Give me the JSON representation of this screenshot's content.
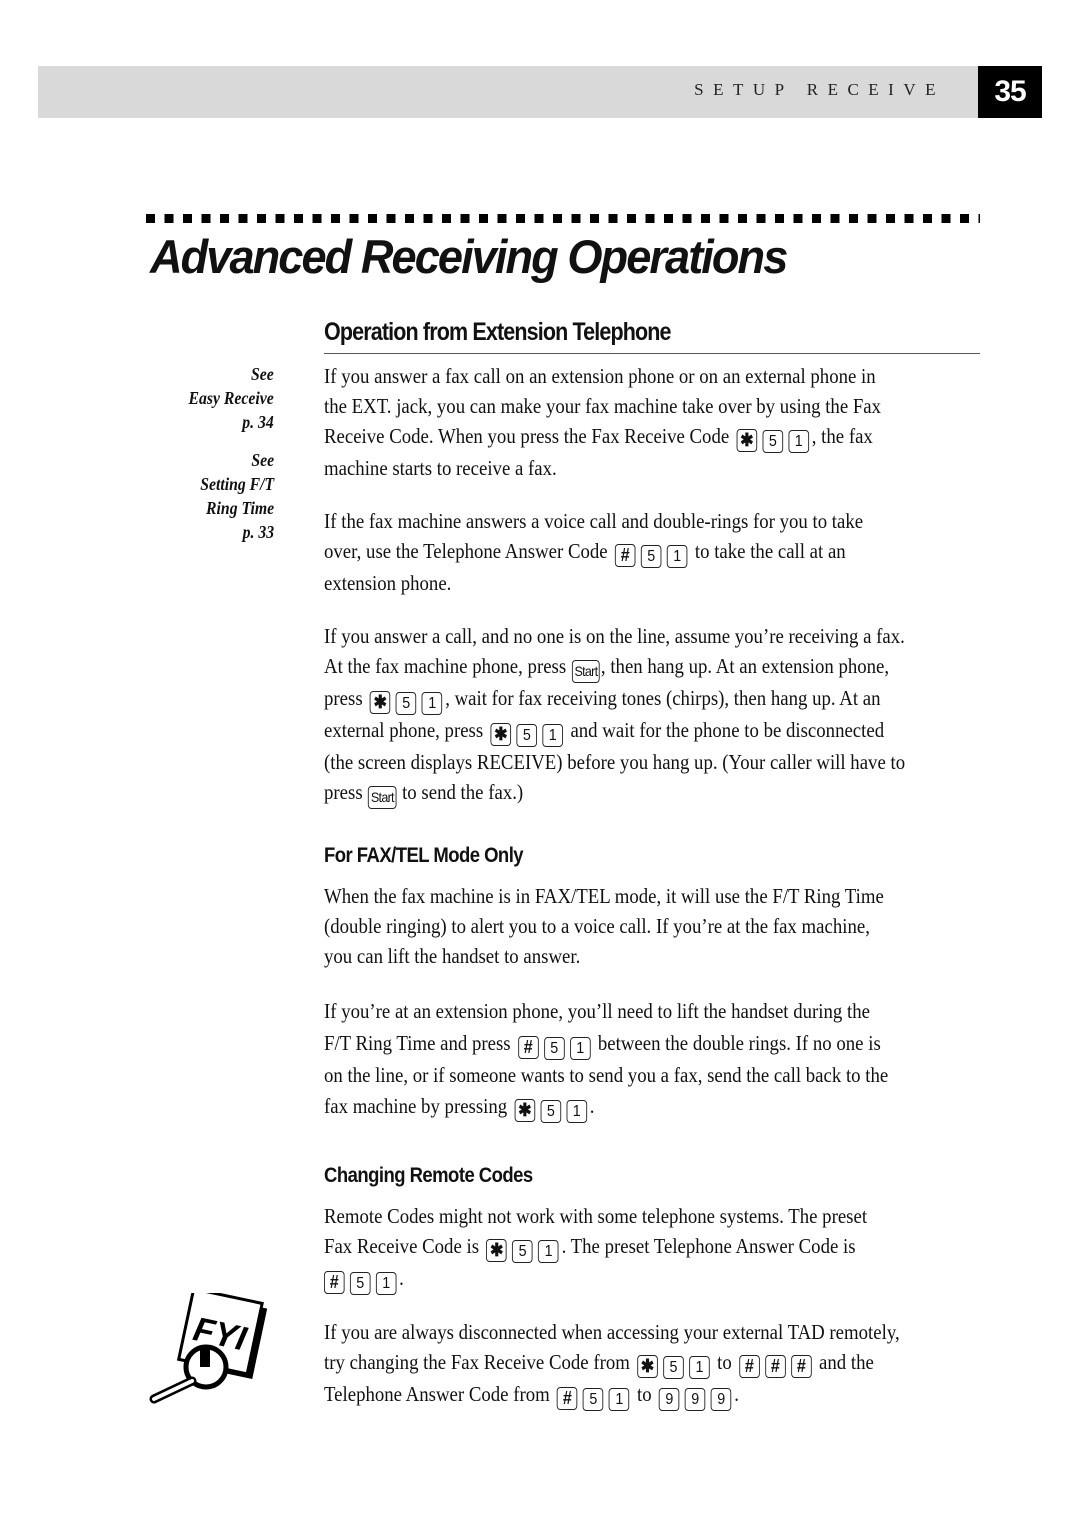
{
  "header": {
    "section_label": "SETUP RECEIVE",
    "page_number": "35"
  },
  "chapter": {
    "title": "Advanced Receiving Operations"
  },
  "section": {
    "title": "Operation from Extension Telephone"
  },
  "sidenotes": [
    {
      "lines": [
        "See",
        "Easy Receive",
        "p. 34"
      ]
    },
    {
      "lines": [
        "See",
        "Setting F/T",
        "Ring Time",
        "p. 33"
      ]
    }
  ],
  "keys": {
    "star": "✱",
    "hash": "#",
    "five": "5",
    "one": "1",
    "nine": "9",
    "start": "Start"
  },
  "paragraphs": {
    "p1": {
      "l1": "If you answer a fax call on an extension phone or on an external phone in",
      "l2": "the EXT. jack, you can make your fax machine take over by using the Fax",
      "l3a": "Receive Code. When you press the Fax Receive Code",
      "l3b": ", the fax",
      "l4": "machine starts to receive a fax."
    },
    "p2": {
      "l1": "If the fax machine answers a voice call and double-rings for you to take",
      "l2a": "over, use the Telephone Answer Code",
      "l2b": "to take the call at an",
      "l3": "extension phone."
    },
    "p3": {
      "l1": "If you answer a call, and no one is on the line, assume you’re receiving a fax.",
      "l2a": "At the fax machine phone, press",
      "l2b": ", then hang up. At an extension phone,",
      "l3a": "press",
      "l3b": ", wait for fax receiving tones (chirps), then hang up.  At an",
      "l4a": "external phone, press",
      "l4b": "and wait for the phone to be disconnected",
      "l5": "(the screen displays RECEIVE) before you hang up. (Your caller will have to",
      "l6a": "press",
      "l6b": "to send the fax.)"
    },
    "sub1_title": "For FAX/TEL Mode Only",
    "p4": {
      "l1": "When the fax machine is in FAX/TEL mode, it will use the F/T Ring Time",
      "l2": "(double ringing) to alert you to a voice call. If you’re at the fax machine,",
      "l3": "you can lift the handset to answer."
    },
    "p5": {
      "l1": "If you’re at an extension phone, you’ll need to lift the handset during the",
      "l2a": "F/T Ring Time and press",
      "l2b": "between the double rings. If no one is",
      "l3": "on the line, or if someone wants to send you a fax, send the call back to the",
      "l4a": "fax machine by pressing",
      "l4b": "."
    },
    "sub2_title": "Changing Remote Codes",
    "p6": {
      "l1": "Remote Codes might not work with some telephone systems. The preset",
      "l2a": "Fax Receive Code is",
      "l2b": ". The preset Telephone Answer Code is",
      "l3b": "."
    },
    "p7": {
      "l1": "If you are always disconnected when accessing your external TAD remotely,",
      "l2a": "try changing the Fax Receive Code from",
      "l2b": "to",
      "l2c": "and the",
      "l3a": "Telephone Answer Code from",
      "l3b": "to",
      "l3c": "."
    }
  },
  "fyi": {
    "label": "FYI"
  }
}
